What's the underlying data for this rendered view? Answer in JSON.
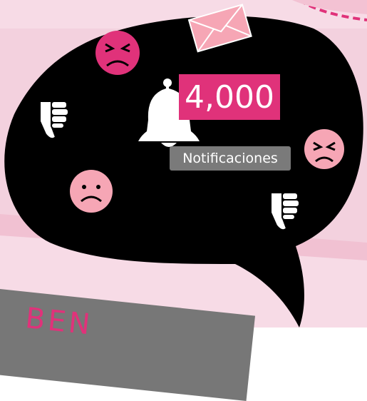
{
  "colors": {
    "background": "#f3d1de",
    "bubble": "#000000",
    "accent": "#e0327a",
    "angry_face": "#e0327a",
    "sad_face": "#f6a6b5",
    "icon_white": "#ffffff",
    "label_gray": "#7a7a7a"
  },
  "icons": [
    "envelope-icon",
    "bell-icon",
    "angry-face-icon",
    "sad-face-icon",
    "thumbs-down-icon"
  ],
  "notification": {
    "count": "4,000",
    "label": "Notificaciones"
  },
  "banner": {
    "text": "BEN"
  }
}
